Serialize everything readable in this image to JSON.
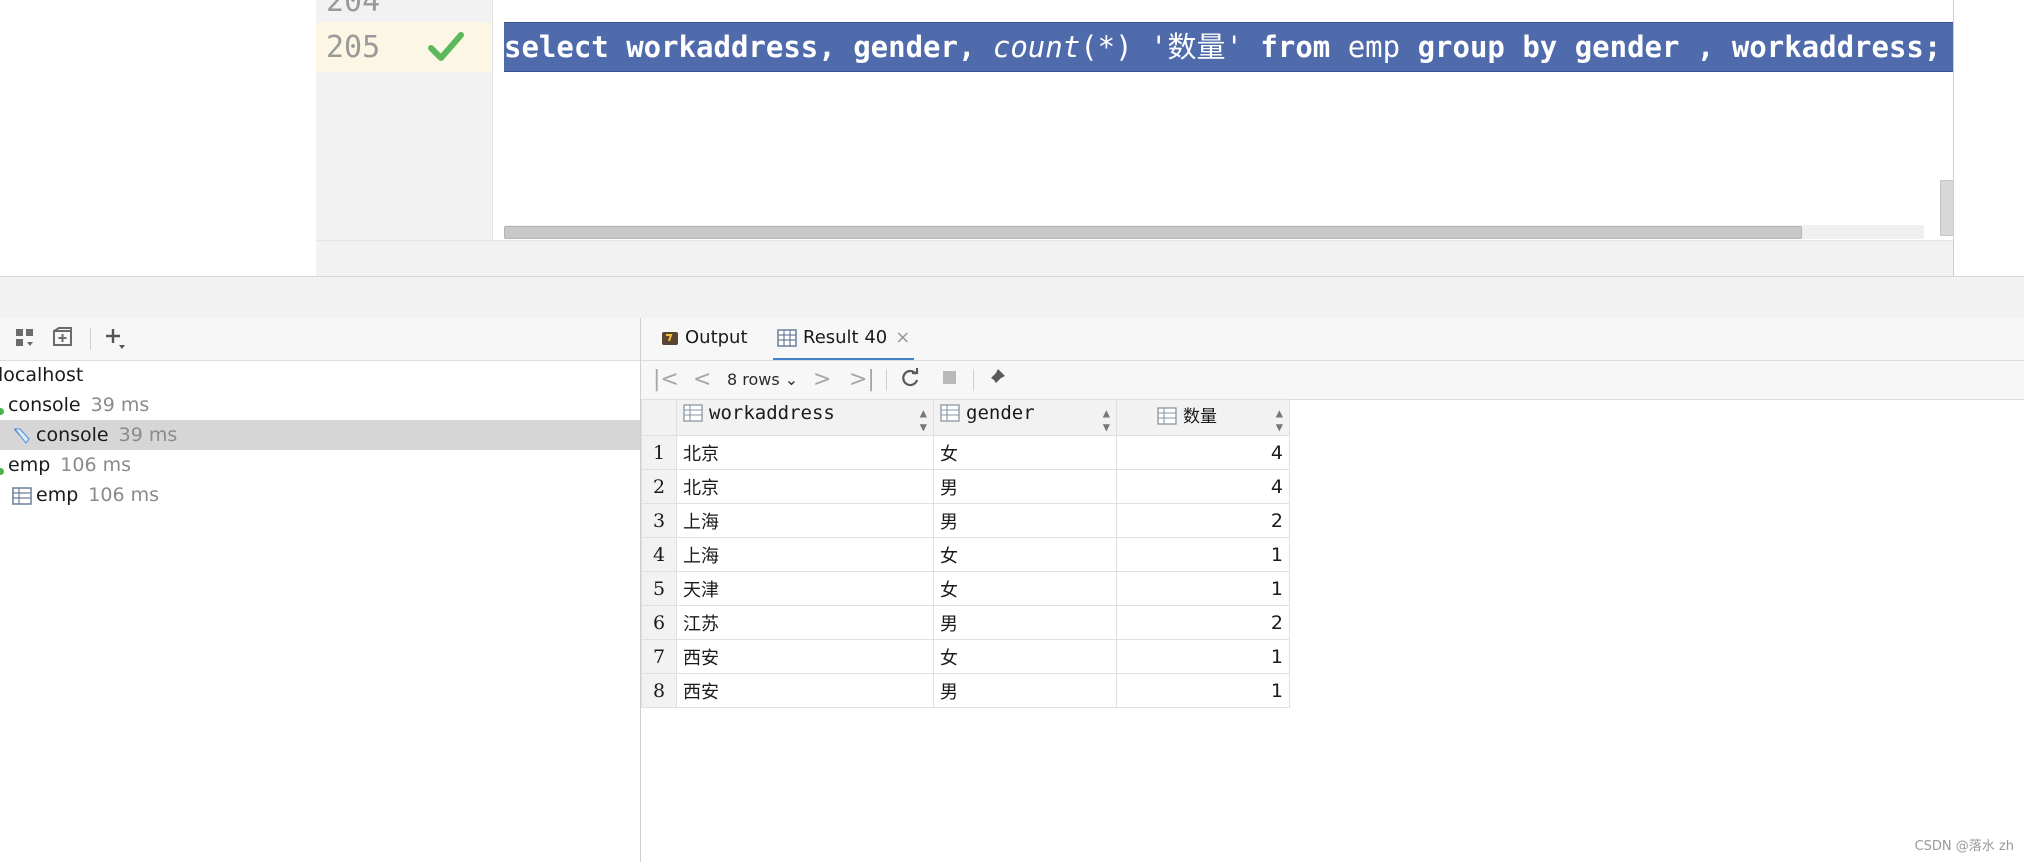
{
  "editor": {
    "line_numbers": {
      "prev": "204",
      "current": "205"
    },
    "code": {
      "t1": "select workaddress, gender, ",
      "t2": "count",
      "t3": "(*) ",
      "t4": "'数量'",
      "t5": " from ",
      "t6": "emp",
      "t7": " group by gender , workaddress;"
    }
  },
  "services": {
    "tree": [
      {
        "label": "localhost",
        "time": ""
      },
      {
        "label": "console",
        "time": "39 ms"
      },
      {
        "label": "console",
        "time": "39 ms"
      },
      {
        "label": "emp",
        "time": "106 ms"
      },
      {
        "label": "emp",
        "time": "106 ms"
      }
    ]
  },
  "result": {
    "tabs": {
      "output": "Output",
      "result": "Result 40"
    },
    "rows_selector": "8 rows",
    "columns": [
      "workaddress",
      "gender",
      "数量"
    ],
    "rows": [
      {
        "n": "1",
        "workaddress": "北京",
        "gender": "女",
        "count": "4"
      },
      {
        "n": "2",
        "workaddress": "北京",
        "gender": "男",
        "count": "4"
      },
      {
        "n": "3",
        "workaddress": "上海",
        "gender": "男",
        "count": "2"
      },
      {
        "n": "4",
        "workaddress": "上海",
        "gender": "女",
        "count": "1"
      },
      {
        "n": "5",
        "workaddress": "天津",
        "gender": "女",
        "count": "1"
      },
      {
        "n": "6",
        "workaddress": "江苏",
        "gender": "男",
        "count": "2"
      },
      {
        "n": "7",
        "workaddress": "西安",
        "gender": "女",
        "count": "1"
      },
      {
        "n": "8",
        "workaddress": "西安",
        "gender": "男",
        "count": "1"
      }
    ]
  },
  "watermark": "CSDN @落水 zh",
  "colors": {
    "selection": "#4f6bab",
    "check": "#5cb85c",
    "tab_underline": "#4083c9"
  }
}
